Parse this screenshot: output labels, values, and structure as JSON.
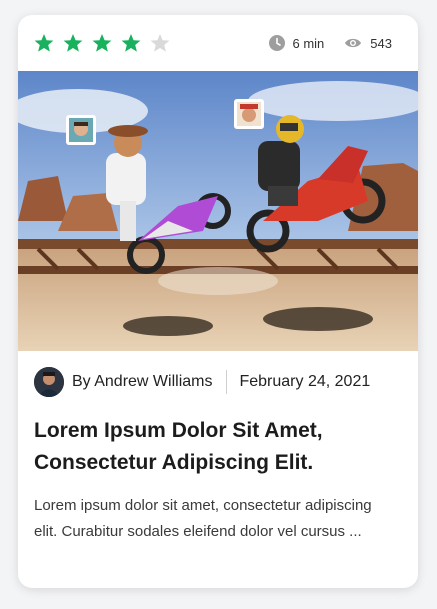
{
  "rating": {
    "value": 4,
    "max": 5,
    "filled_color": "#19b15e",
    "empty_color": "#d9d9d9"
  },
  "meta": {
    "read_time": "6 min",
    "views": "543",
    "read_time_icon": "clock-icon",
    "views_icon": "eye-icon"
  },
  "hero": {
    "image_subject": "game-screenshot"
  },
  "byline": {
    "author": "By Andrew Williams",
    "date": "February 24, 2021"
  },
  "article": {
    "title": "Lorem Ipsum Dolor Sit Amet, Consectetur Adipiscing Elit.",
    "excerpt": "Lorem ipsum dolor sit amet, consectetur adipiscing elit. Curabitur sodales eleifend dolor vel cursus ..."
  }
}
